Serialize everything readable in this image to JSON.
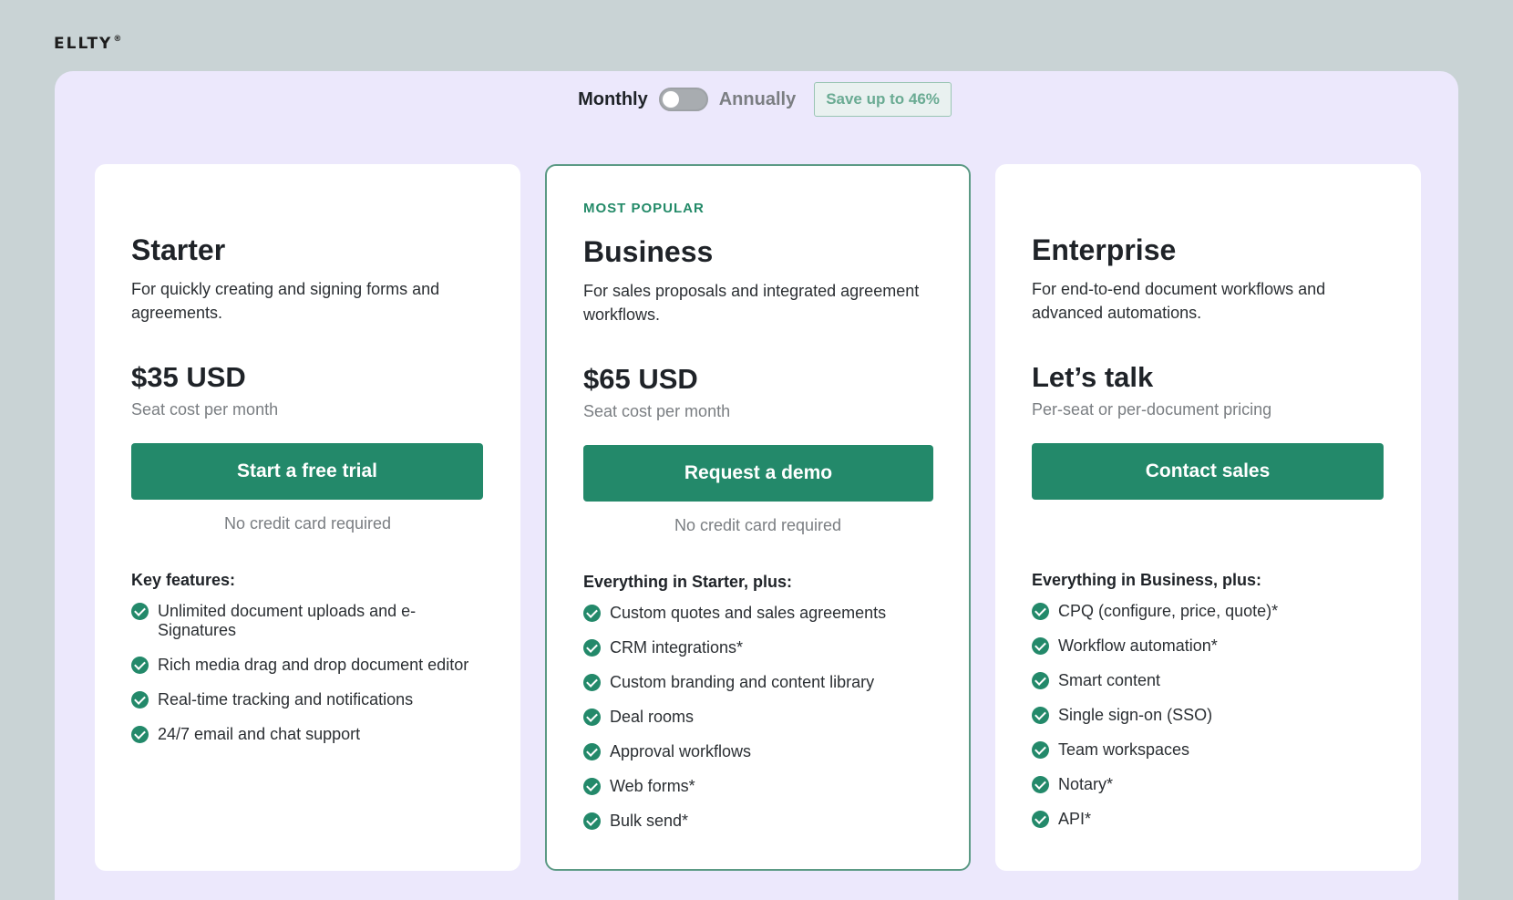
{
  "brand": {
    "logo": "ELLTY",
    "logo_mark": "®"
  },
  "billing": {
    "monthly_label": "Monthly",
    "annually_label": "Annually",
    "save_badge": "Save up to 46%",
    "selected": "Monthly"
  },
  "colors": {
    "accent": "#23896a",
    "panel": "#ece8fc",
    "page_bg": "#c9d3d5"
  },
  "plans": [
    {
      "eyebrow": "",
      "name": "Starter",
      "description": "For quickly creating and signing forms and agreements.",
      "price": "$35 USD",
      "price_note": "Seat cost per month",
      "cta": "Start a free trial",
      "cta_note": "No credit card required",
      "features_heading": "Key features:",
      "features": [
        "Unlimited document uploads and e-Signatures",
        "Rich media drag and drop document editor",
        "Real-time tracking and notifications",
        "24/7 email and chat support"
      ]
    },
    {
      "eyebrow": "MOST POPULAR",
      "name": "Business",
      "description": "For sales proposals and integrated agreement workflows.",
      "price": "$65 USD",
      "price_note": "Seat cost per month",
      "cta": "Request a demo",
      "cta_note": "No credit card required",
      "features_heading": "Everything in Starter, plus:",
      "features": [
        "Custom quotes and sales agreements",
        "CRM integrations*",
        "Custom branding and content library",
        "Deal rooms",
        "Approval workflows",
        "Web forms*",
        "Bulk send*"
      ]
    },
    {
      "eyebrow": "",
      "name": "Enterprise",
      "description": "For end-to-end document workflows and advanced automations.",
      "price": "Let’s talk",
      "price_note": "Per-seat or per-document pricing",
      "cta": "Contact sales",
      "cta_note": "",
      "features_heading": "Everything in Business, plus:",
      "features": [
        "CPQ (configure, price, quote)*",
        "Workflow automation*",
        "Smart content",
        "Single sign-on (SSO)",
        "Team workspaces",
        "Notary*",
        "API*"
      ]
    }
  ]
}
